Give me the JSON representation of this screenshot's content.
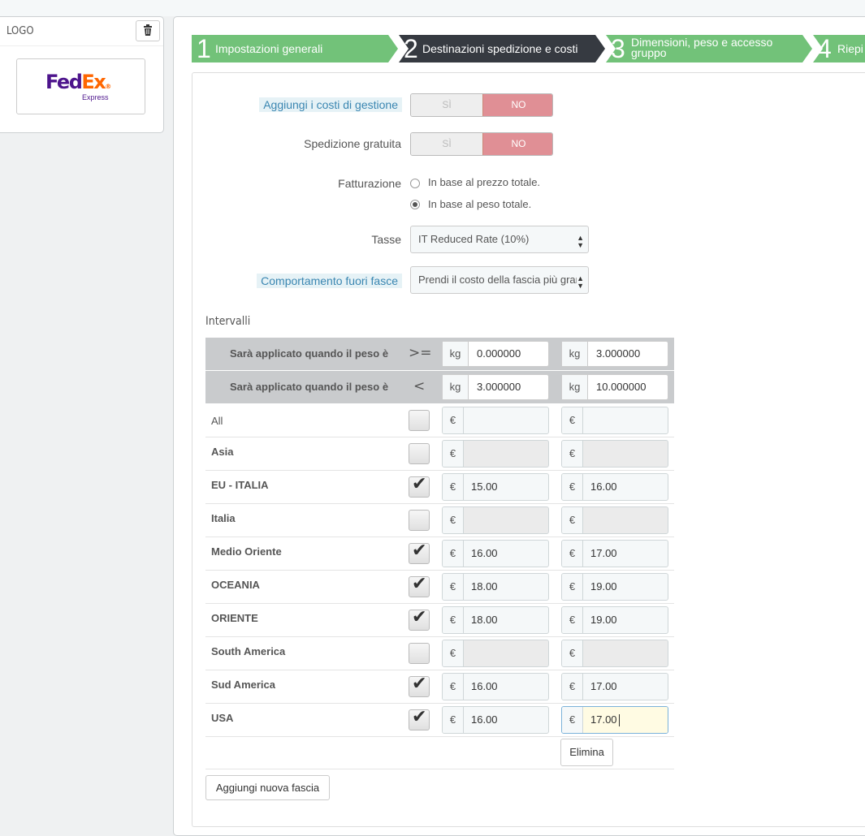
{
  "logo_panel": {
    "title": "LOGO",
    "delete_icon": "trash-icon",
    "carrier_logo": {
      "text_main_1": "Fed",
      "text_main_2": "Ex",
      "text_sub": "Express"
    }
  },
  "wizard": {
    "steps": [
      {
        "num": "1",
        "label": "Impostazioni generali",
        "color": "#72c279"
      },
      {
        "num": "2",
        "label": "Destinazioni spedizione e costi",
        "color": "#363a41"
      },
      {
        "num": "3",
        "label_1": "Dimensioni, peso e accesso",
        "label_2": "gruppo",
        "color": "#72c279"
      },
      {
        "num": "4",
        "label": "Riepi",
        "color": "#72c279"
      }
    ]
  },
  "form": {
    "handling_costs": {
      "label": "Aggiungi i costi di gestione",
      "yes": "SÌ",
      "no": "NO",
      "value": "NO"
    },
    "free_shipping": {
      "label": "Spedizione gratuita",
      "yes": "SÌ",
      "no": "NO",
      "value": "NO"
    },
    "billing": {
      "label": "Fatturazione",
      "options": [
        "In base al prezzo totale.",
        "In base al peso totale."
      ],
      "selected": "In base al peso totale."
    },
    "tax": {
      "label": "Tasse",
      "value": "IT Reduced Rate (10%)"
    },
    "out_of_range": {
      "label": "Comportamento fuori fasce",
      "value": "Prendi il costo della fascia più grande"
    }
  },
  "ranges": {
    "title": "Intervalli",
    "from_row": {
      "label": "Sarà applicato quando il peso è",
      "operator": ">=",
      "unit": "kg",
      "values": [
        "0.000000",
        "3.000000"
      ]
    },
    "to_row": {
      "label": "Sarà applicato quando il peso è",
      "operator": "<",
      "unit": "kg",
      "values": [
        "3.000000",
        "10.000000"
      ]
    },
    "currency": "€",
    "zones": [
      {
        "name": "All",
        "checked": false,
        "prices": [
          "",
          ""
        ]
      },
      {
        "name": "Asia",
        "checked": false,
        "prices": [
          "",
          ""
        ]
      },
      {
        "name": "EU - ITALIA",
        "checked": true,
        "prices": [
          "15.00",
          "16.00"
        ]
      },
      {
        "name": "Italia",
        "checked": false,
        "prices": [
          "",
          ""
        ]
      },
      {
        "name": "Medio Oriente",
        "checked": true,
        "prices": [
          "16.00",
          "17.00"
        ]
      },
      {
        "name": "OCEANIA",
        "checked": true,
        "prices": [
          "18.00",
          "19.00"
        ]
      },
      {
        "name": "ORIENTE",
        "checked": true,
        "prices": [
          "18.00",
          "19.00"
        ]
      },
      {
        "name": "South America",
        "checked": false,
        "prices": [
          "",
          ""
        ]
      },
      {
        "name": "Sud America",
        "checked": true,
        "prices": [
          "16.00",
          "17.00"
        ]
      },
      {
        "name": "USA",
        "checked": true,
        "prices": [
          "16.00",
          "17.00"
        ]
      }
    ],
    "delete_button": "Elimina",
    "add_button": "Aggiungi nuova fascia"
  }
}
